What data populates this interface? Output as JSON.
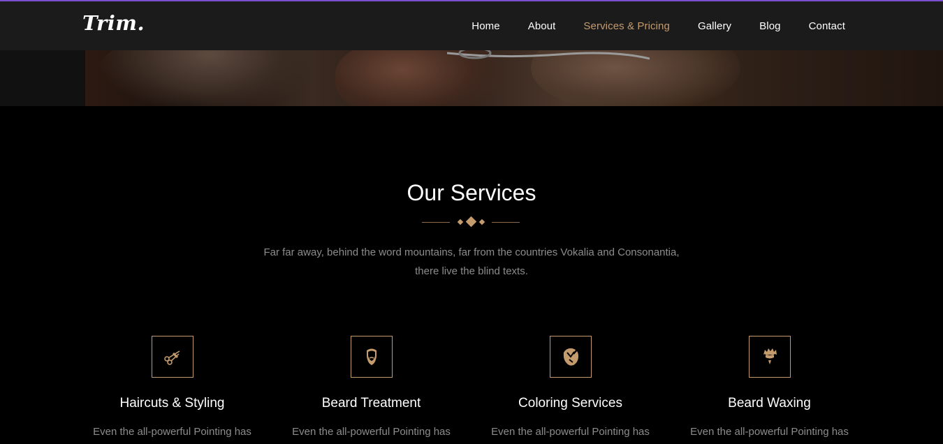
{
  "brand": {
    "name": "Trim."
  },
  "nav": {
    "items": [
      {
        "label": "Home",
        "active": false
      },
      {
        "label": "About",
        "active": false
      },
      {
        "label": "Services & Pricing",
        "active": true
      },
      {
        "label": "Gallery",
        "active": false
      },
      {
        "label": "Blog",
        "active": false
      },
      {
        "label": "Contact",
        "active": false
      }
    ]
  },
  "services_section": {
    "title": "Our Services",
    "description": "Far far away, behind the word mountains, far from the countries Vokalia and Consonantia, there live the blind texts.",
    "items": [
      {
        "icon": "scissors-icon",
        "title": "Haircuts & Styling",
        "text": "Even the all-powerful Pointing has"
      },
      {
        "icon": "beard-icon",
        "title": "Beard Treatment",
        "text": "Even the all-powerful Pointing has"
      },
      {
        "icon": "hair-coloring-icon",
        "title": "Coloring Services",
        "text": "Even the all-powerful Pointing has"
      },
      {
        "icon": "beard-waxing-icon",
        "title": "Beard Waxing",
        "text": "Even the all-powerful Pointing has"
      }
    ]
  },
  "colors": {
    "accent": "#c49b6d",
    "top_bar": "#7a4fd0",
    "navbar_bg": "#1c1b1c",
    "page_bg": "#000000",
    "muted_text": "#8c8c8c"
  }
}
